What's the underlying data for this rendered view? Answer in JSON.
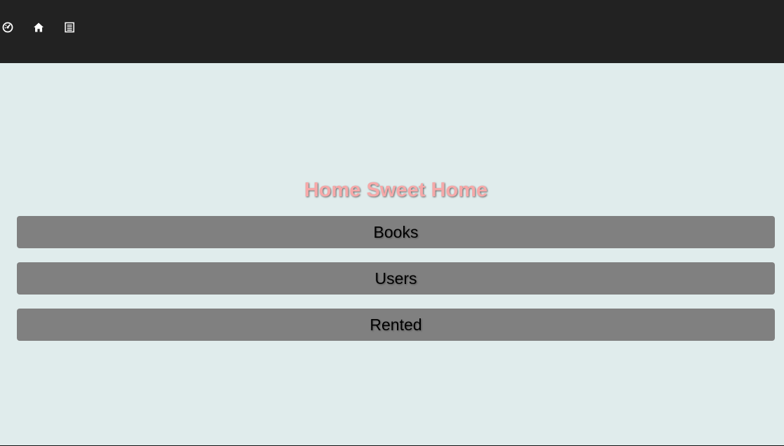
{
  "navbar": {
    "icons": [
      "dashboard-icon",
      "home-icon",
      "list-icon"
    ]
  },
  "main": {
    "title": "Home Sweet Home",
    "buttons": [
      {
        "label": "Books"
      },
      {
        "label": "Users"
      },
      {
        "label": "Rented"
      }
    ]
  },
  "colors": {
    "navbar_bg": "#222222",
    "page_bg": "#e0ecec",
    "title": "#f6a9a9",
    "button_bg": "#808080"
  }
}
